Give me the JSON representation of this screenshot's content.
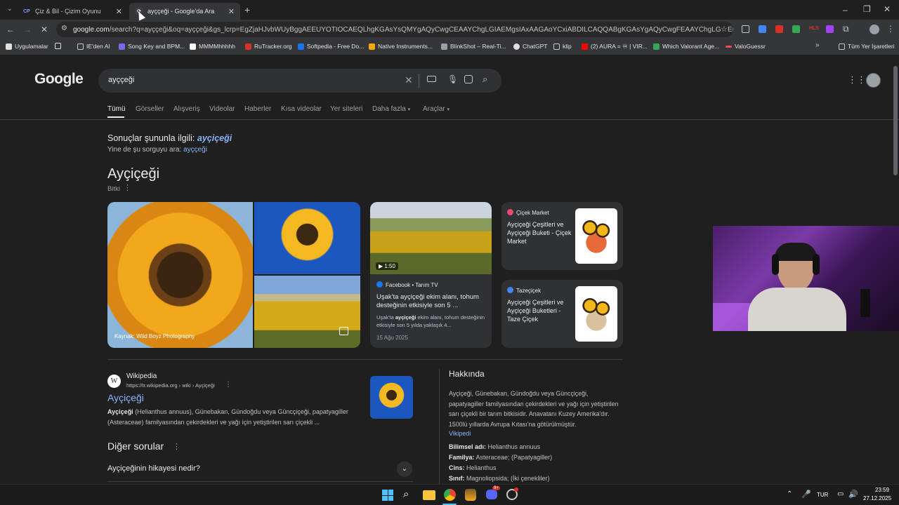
{
  "tabs": [
    {
      "favicon": "CP",
      "title": "Çiz & Bil - Çizim Oyunu"
    },
    {
      "favicon": "G",
      "title": "ayççeği - Google'da Ara"
    }
  ],
  "omnibox": {
    "host": "google.com",
    "path": "/search?q=ayççeği&oq=ayççeği&gs_lcrp=EgZjaHJvbWUyBggAEEUYOTIOCAEQLhgKGAsYsQMYgAQyCwgCEAAYChgLGIAEMgsIAxAAGAoYCxiABDILCAQQABgKGAsYgAQyCwgFEAAYChgLGIAEMgsIBhAAGAoYCxi..."
  },
  "bookmarks": [
    {
      "label": "Uygulamalar",
      "color": "#e0e0e0"
    },
    {
      "label": "",
      "color": "#e0e0e0"
    },
    {
      "label": "IE'den Al",
      "color": "#c4c7c5"
    },
    {
      "label": "Song Key and BPM...",
      "color": "#7b68ee"
    },
    {
      "label": "MMMMhhhhh",
      "color": "#ffffff"
    },
    {
      "label": "RuTracker.org",
      "color": "#d93025"
    },
    {
      "label": "Softpedia - Free Do...",
      "color": "#1a73e8"
    },
    {
      "label": "Native Instruments...",
      "color": "#f9ab00"
    },
    {
      "label": "BlinkShot – Real-Ti...",
      "color": "#9aa0a6"
    },
    {
      "label": "ChatGPT",
      "color": "#e0e0e0"
    },
    {
      "label": "klip",
      "color": "#c4c7c5"
    },
    {
      "label": "(2) AURA = ♾ | VIR...",
      "color": "#ff0000"
    },
    {
      "label": "Which Valorant Age...",
      "color": "#34a853"
    },
    {
      "label": "ValoGuessr",
      "color": "#ff4655"
    },
    {
      "label": "Tüm Yer İşaretleri",
      "color": "#c4c7c5"
    }
  ],
  "search": {
    "query": "ayççeği"
  },
  "nav_tabs": [
    "Tümü",
    "Görseller",
    "Alışveriş",
    "Videolar",
    "Haberler",
    "Kısa videolar",
    "Yer siteleri",
    "Daha fazla",
    "Araçlar"
  ],
  "spell": {
    "showing_prefix": "Sonuçlar şununla ilgili:",
    "showing_term": "ayçiçeği",
    "instead_prefix": "Yine de şu sorguyu ara:",
    "instead_term": "ayççeği"
  },
  "entity": {
    "title": "Ayçiçeği",
    "subtitle": "Bitki",
    "image_credit": "Kaynak: Wild Boyz Photography"
  },
  "video": {
    "duration": "1:50",
    "source": "Facebook • Tarım TV",
    "title": "Uşak'ta ayçiçeği ekim alanı, tohum desteğinin etkisiyle son 5 ...",
    "snippet_bold": "ayçiçeği",
    "snippet_pre": "Uşak'ta ",
    "snippet_post": " ekim alanı, tohum desteğinin etkisiyle son 5 yılda yaklaşık 4...",
    "date": "15 Ağu 2025"
  },
  "shops": [
    {
      "source": "Çiçek Market",
      "title": "Ayçiçeği Çeşitleri ve Ayçiçeği Buketi - Çiçek Market"
    },
    {
      "source": "Tazeçiçek",
      "title": "Ayçiçeği Çeşitleri ve Ayçiçeği Buketleri - Taze Çiçek"
    }
  ],
  "wiki": {
    "site": "Wikipedia",
    "url": "https://tr.wikipedia.org › wiki › Ayçiçeği",
    "title": "Ayçiçeği",
    "snippet_bold": "Ayçiçeği",
    "snippet": " (Helianthus annuus), Günebakan, Gündoğdu veya Güncçiçeği, papatyagiller (Asteraceae) familyasından çekirdekleri ve yağı için yetiştirilen sarı çiçekli ..."
  },
  "other_questions": {
    "title": "Diğer sorular",
    "q1": "Ayçiçeğinin hikayesi nedir?"
  },
  "about": {
    "title": "Hakkında",
    "text": "Ayçiçeği, Günebakan, Gündoğdu veya Güncçiçeği, papatyagiller familyasından çekirdekleri ve yağı için yetiştirilen sarı çiçekli bir tarım bitkisidir. Anavatanı Kuzey Amerika'dır. 1500lü yıllarda Avrupa Kıtası'na götürülmüştür.",
    "link": "Vikipedi",
    "facts": [
      {
        "k": "Bilimsel adı:",
        "v": " Helianthus annuus"
      },
      {
        "k": "Familya:",
        "v": " Asteraceae; (Papatyagiller)"
      },
      {
        "k": "Cins:",
        "v": " Helianthus"
      },
      {
        "k": "Sınıf:",
        "v": " Magnoliopsida; (İki çenekliler)"
      }
    ]
  },
  "taskbar": {
    "lang": "TUR",
    "time": "23:59",
    "date": "27.12.2025",
    "discord_badge": "9+"
  },
  "colors": {
    "accent_link": "#8ab4f8",
    "bg": "#1f1f1f",
    "card": "#303134"
  }
}
